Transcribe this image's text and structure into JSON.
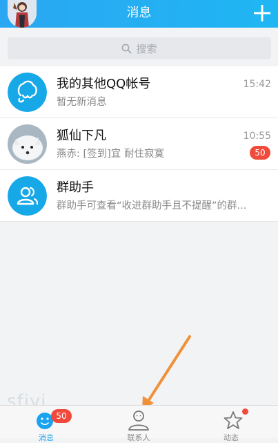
{
  "header": {
    "title": "消息",
    "accent": "#2aa7f2"
  },
  "search": {
    "placeholder": "搜索"
  },
  "conversations": [
    {
      "name": "我的其他QQ帐号",
      "preview": "暂无新消息",
      "time": "15:42",
      "badge": "",
      "avatar_icon": "qq-account-icon"
    },
    {
      "name": "狐仙下凡",
      "preview": "燕赤: [签到]宜 耐住寂寞",
      "time": "10:55",
      "badge": "50",
      "avatar_icon": "white-fox-avatar"
    },
    {
      "name": "群助手",
      "preview": "群助手可查看“收进群助手且不提醒”的群...",
      "time": "",
      "badge": "",
      "avatar_icon": "group-assistant-icon"
    }
  ],
  "tabbar": {
    "tabs": [
      {
        "label": "消息",
        "icon": "message-penguin-icon",
        "badge": "50",
        "active": true
      },
      {
        "label": "联系人",
        "icon": "contacts-icon",
        "badge": "",
        "active": false
      },
      {
        "label": "动态",
        "icon": "star-icon",
        "badge": "",
        "active": false
      }
    ]
  },
  "watermark": "sfjyi",
  "colors": {
    "badge": "#f04a3c",
    "annotation_arrow": "#f0913a",
    "active_tab": "#1aa3ef"
  }
}
